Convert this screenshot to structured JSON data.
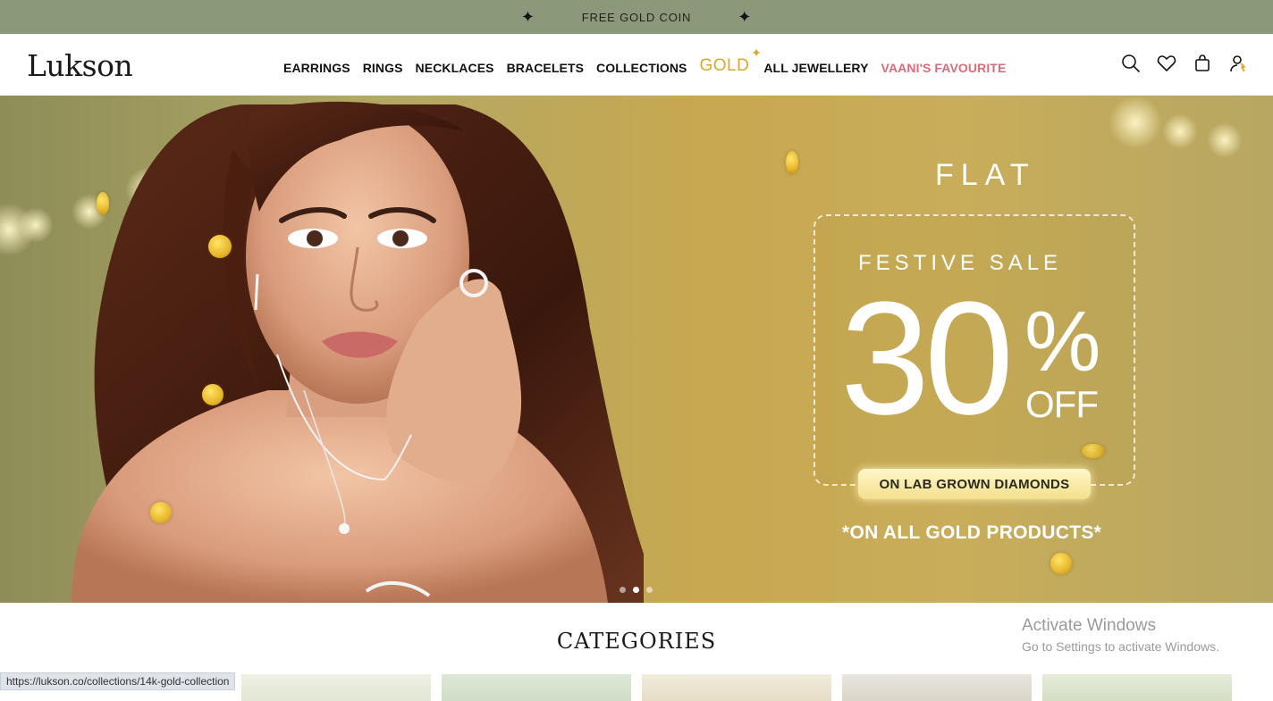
{
  "announcement": {
    "text": "FREE GOLD COIN",
    "spark_icon": "four-point-star-icon"
  },
  "brand": {
    "logo": "Lukson"
  },
  "nav": {
    "items": [
      {
        "label": "EARRINGS"
      },
      {
        "label": "RINGS"
      },
      {
        "label": "NECKLACES"
      },
      {
        "label": "BRACELETS"
      },
      {
        "label": "COLLECTIONS"
      },
      {
        "label": "GOLD"
      },
      {
        "label": "ALL JEWELLERY"
      },
      {
        "label": "VAANI'S FAVOURITE"
      }
    ],
    "gold_color": "#d9a92a",
    "highlight_color": "#d96b7a"
  },
  "header_icons": [
    "search-icon",
    "heart-icon",
    "bag-icon",
    "user-icon"
  ],
  "hero": {
    "flat": "FLAT",
    "festive": "FESTIVE SALE",
    "percent_number": "30",
    "percent_sign": "%",
    "off": "OFF",
    "pill": "ON LAB GROWN DIAMONDS",
    "footnote": "*ON ALL GOLD PRODUCTS*",
    "slide_count": 3,
    "active_slide": 2
  },
  "categories": {
    "title": "CATEGORIES",
    "card_count": 5
  },
  "status_bar": {
    "url": "https://lukson.co/collections/14k-gold-collection"
  },
  "windows_watermark": {
    "line1": "Activate Windows",
    "line2": "Go to Settings to activate Windows."
  },
  "colors": {
    "announcement_bg": "#8b987a",
    "hero_gold": "#c8a850"
  }
}
